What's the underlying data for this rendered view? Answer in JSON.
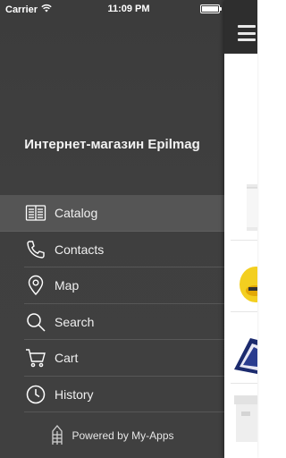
{
  "status_bar": {
    "carrier": "Carrier",
    "time": "11:09 PM"
  },
  "drawer": {
    "shop_title": "Интернет-магазин Epilmag",
    "menu": [
      {
        "label": "Catalog",
        "icon": "book-icon",
        "active": true
      },
      {
        "label": "Contacts",
        "icon": "phone-icon",
        "active": false
      },
      {
        "label": "Map",
        "icon": "map-pin-icon",
        "active": false
      },
      {
        "label": "Search",
        "icon": "search-icon",
        "active": false
      },
      {
        "label": "Cart",
        "icon": "cart-icon",
        "active": false
      },
      {
        "label": "History",
        "icon": "clock-icon",
        "active": false
      }
    ],
    "footer_text": "Powered by My-Apps"
  },
  "colors": {
    "drawer_bg": "#404040",
    "active_item_bg": "#555555",
    "header_bg": "#2e2e2e",
    "text": "#ffffff"
  }
}
